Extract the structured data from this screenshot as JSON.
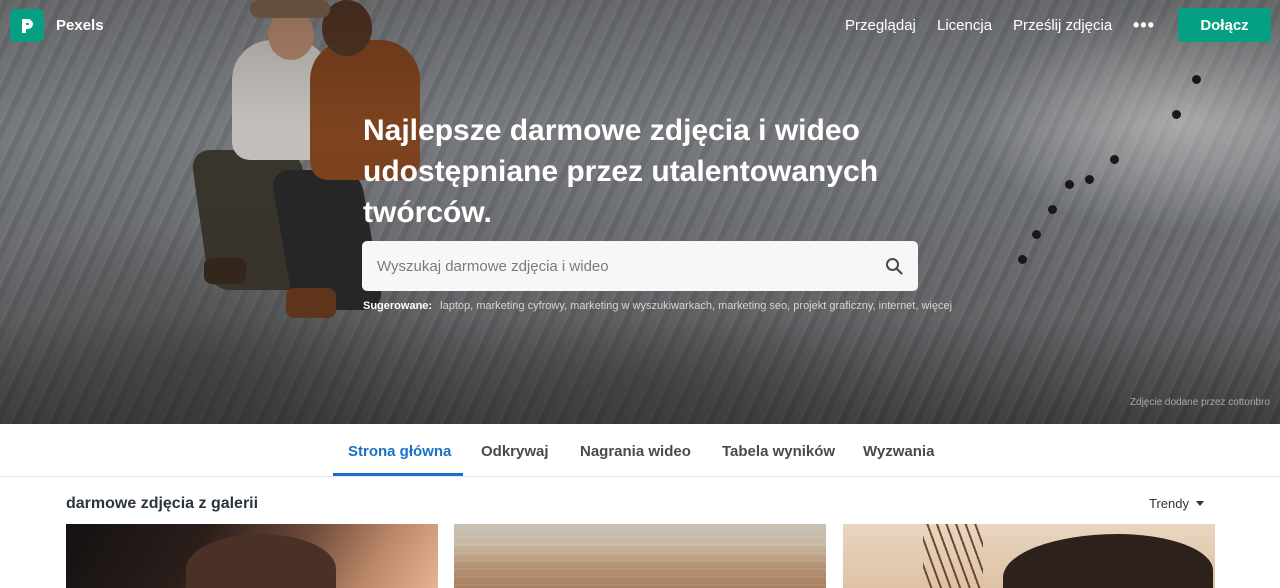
{
  "brand": {
    "name": "Pexels",
    "accent": "#05a081"
  },
  "nav": {
    "links": [
      "Przeglądaj",
      "Licencja",
      "Prześlij zdjęcia"
    ],
    "more_label": "•••",
    "join_label": "Dołącz"
  },
  "hero": {
    "title": "Najlepsze darmowe zdjęcia i wideo udostępniane przez utalentowanych twórców.",
    "search": {
      "placeholder": "Wyszukaj darmowe zdjęcia i wideo",
      "value": ""
    },
    "suggested_label": "Sugerowane:",
    "suggested_items": "laptop, marketing cyfrowy, marketing w wyszukiwarkach, marketing seo, projekt graficzny, internet, więcej",
    "credit": "Zdjęcie dodane przez cottonbro"
  },
  "tabs": {
    "items": [
      "Strona główna",
      "Odkrywaj",
      "Nagrania wideo",
      "Tabela wyników",
      "Wyzwania"
    ],
    "active_index": 0,
    "active_color": "#1a71c7"
  },
  "gallery": {
    "title": "darmowe zdjęcia z galerii",
    "sort_label": "Trendy"
  },
  "icons": {
    "logo": "pexels-logo-icon",
    "search": "search-icon",
    "more": "more-dots-icon",
    "sort": "caret-down-icon"
  }
}
